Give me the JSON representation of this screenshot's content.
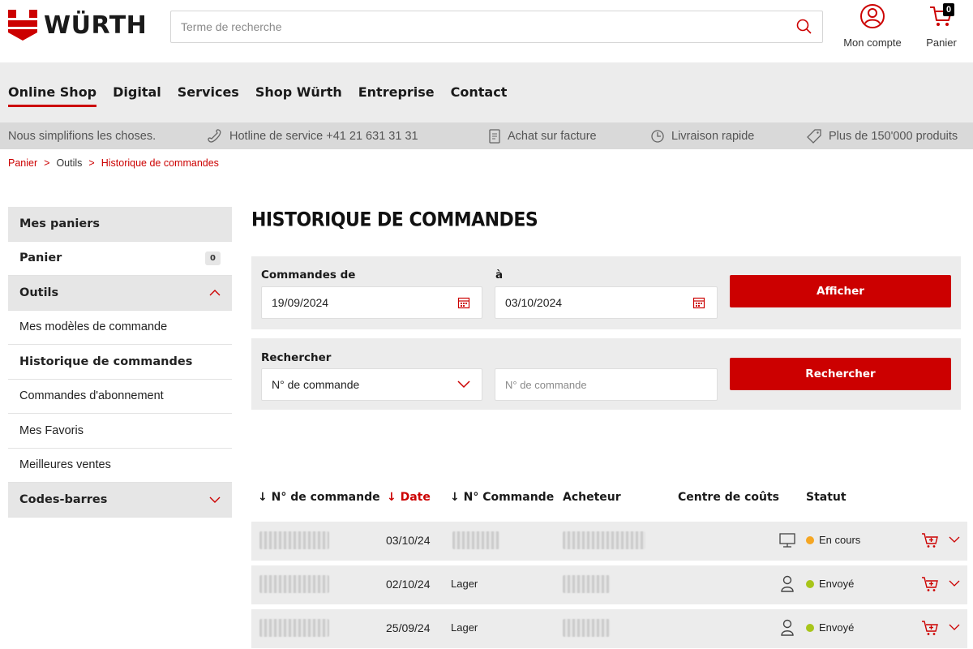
{
  "header": {
    "logo_text": "WÜRTH",
    "search_placeholder": "Terme de recherche",
    "account_label": "Mon compte",
    "cart_label": "Panier",
    "cart_count": "0"
  },
  "mainnav": {
    "items": [
      "Online Shop",
      "Digital",
      "Services",
      "Shop Würth",
      "Entreprise",
      "Contact"
    ],
    "active_index": 0
  },
  "infobar": {
    "slogan": "Nous simplifions les choses.",
    "hotline": "Hotline de service +41 21 631 31 31",
    "invoice": "Achat sur facture",
    "delivery": "Livraison rapide",
    "products": "Plus de 150'000 produits"
  },
  "breadcrumb": [
    "Panier",
    "Outils",
    "Historique de commandes"
  ],
  "sidebar": {
    "my_carts": "Mes paniers",
    "cart": "Panier",
    "cart_badge": "0",
    "tools": "Outils",
    "order_templates": "Mes modèles de commande",
    "order_history": "Historique de commandes",
    "subscriptions": "Commandes d'abonnement",
    "favorites": "Mes Favoris",
    "best_sellers": "Meilleures ventes",
    "barcodes": "Codes-barres"
  },
  "page_title": "HISTORIQUE DE COMMANDES",
  "filter": {
    "from_label": "Commandes de",
    "from_value": "19/09/2024",
    "to_label": "à",
    "to_value": "03/10/2024",
    "show_button": "Afficher"
  },
  "search": {
    "label": "Rechercher",
    "type_value": "N° de commande",
    "input_placeholder": "N° de commande",
    "button": "Rechercher"
  },
  "table": {
    "headers": {
      "order_no": "N° de commande",
      "date": "Date",
      "order_no2": "N° Commande",
      "buyer": "Acheteur",
      "cost_center": "Centre de coûts",
      "status": "Statut"
    },
    "rows": [
      {
        "date": "03/10/24",
        "order2": "",
        "status": "En cours",
        "status_color": "#f5a623",
        "channel_icon": "monitor-icon"
      },
      {
        "date": "02/10/24",
        "order2": "Lager",
        "status": "Envoyé",
        "status_color": "#a8c51a",
        "channel_icon": "user-icon"
      },
      {
        "date": "25/09/24",
        "order2": "Lager",
        "status": "Envoyé",
        "status_color": "#a8c51a",
        "channel_icon": "user-icon"
      }
    ]
  },
  "colors": {
    "brand_red": "#cc0000"
  }
}
